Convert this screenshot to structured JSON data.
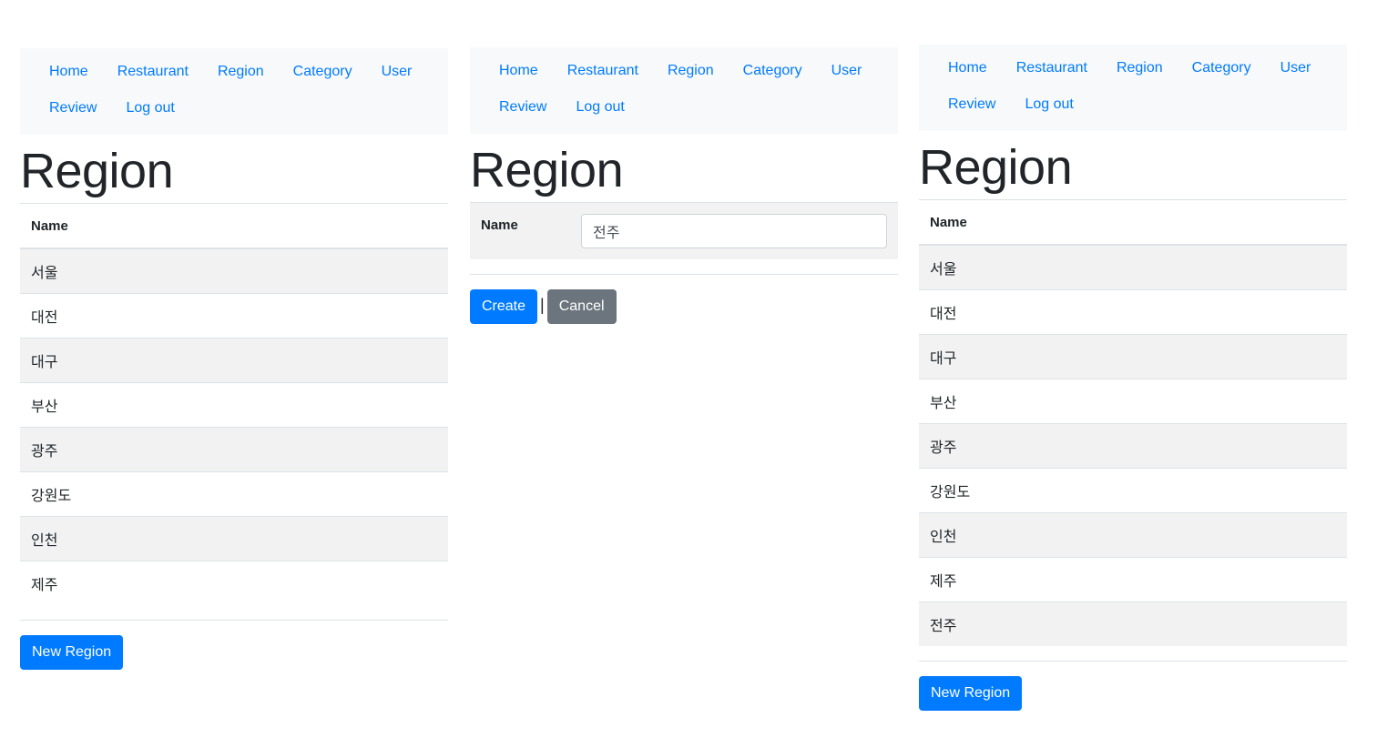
{
  "nav": {
    "items": [
      "Home",
      "Restaurant",
      "Region",
      "Category",
      "User",
      "Review",
      "Log out"
    ]
  },
  "list_page": {
    "title": "Region",
    "column_header": "Name",
    "regions": [
      "서울",
      "대전",
      "대구",
      "부산",
      "광주",
      "강원도",
      "인천",
      "제주"
    ],
    "new_button": "New Region"
  },
  "create_page": {
    "title": "Region",
    "name_label": "Name",
    "name_value": "전주",
    "create_button": "Create",
    "separator": "|",
    "cancel_button": "Cancel"
  },
  "list_page_after": {
    "title": "Region",
    "column_header": "Name",
    "regions": [
      "서울",
      "대전",
      "대구",
      "부산",
      "광주",
      "강원도",
      "인천",
      "제주",
      "전주"
    ],
    "new_button": "New Region"
  },
  "colors": {
    "link": "#007bff",
    "primary": "#007bff",
    "secondary": "#6c757d",
    "navbar_bg": "#f8f9fa",
    "stripe": "#f2f2f2"
  }
}
